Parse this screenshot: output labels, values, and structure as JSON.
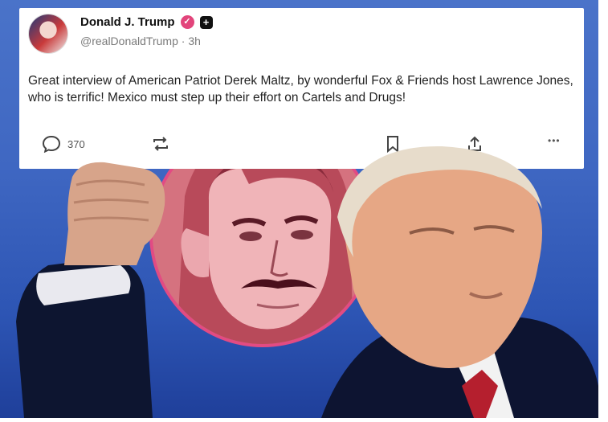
{
  "post": {
    "display_name": "Donald J. Trump",
    "verified_icon": "verified-badge-icon",
    "plus_label": "+",
    "handle": "@realDonaldTrump",
    "separator": " · ",
    "time_ago": "3h",
    "text": "Great interview of American Patriot Derek Maltz, by wonderful Fox & Friends host Lawrence Jones, who is terrific! Mexico must step up their effort on Cartels and Drugs!",
    "actions": {
      "replies_count": "370",
      "more_label": "•••"
    }
  },
  "colors": {
    "background_blue": "#3f67c2",
    "verified_pink": "#e2457b",
    "portrait_ring": "#e24b83"
  }
}
